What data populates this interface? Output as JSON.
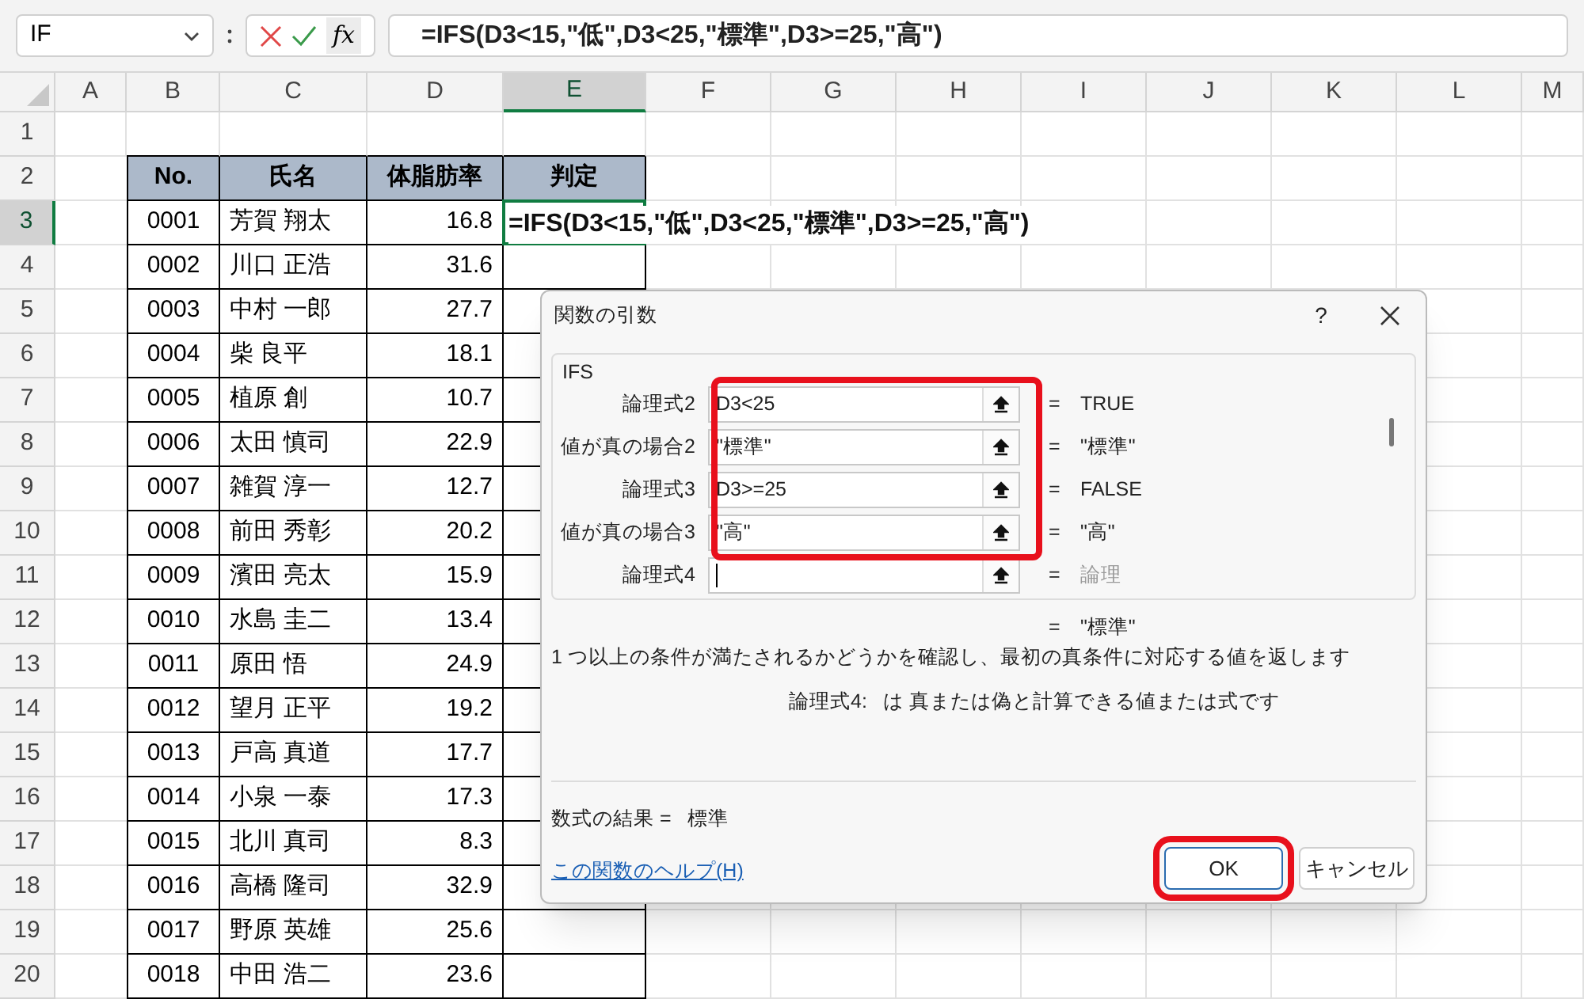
{
  "name_box": {
    "value": "IF"
  },
  "formula_bar": {
    "fx": "fx",
    "value": "=IFS(D3<15,\"低\",D3<25,\"標準\",D3>=25,\"高\")"
  },
  "columns": [
    {
      "label": "A",
      "selected": false
    },
    {
      "label": "B",
      "selected": false
    },
    {
      "label": "C",
      "selected": false
    },
    {
      "label": "D",
      "selected": false
    },
    {
      "label": "E",
      "selected": true
    },
    {
      "label": "F",
      "selected": false
    },
    {
      "label": "G",
      "selected": false
    },
    {
      "label": "H",
      "selected": false
    },
    {
      "label": "I",
      "selected": false
    },
    {
      "label": "J",
      "selected": false
    },
    {
      "label": "K",
      "selected": false
    },
    {
      "label": "L",
      "selected": false
    },
    {
      "label": "M",
      "selected": false
    }
  ],
  "rows": [
    {
      "label": "1",
      "selected": false,
      "kind": "blank"
    },
    {
      "label": "2",
      "selected": false,
      "kind": "header",
      "cells": [
        "No.",
        "氏名",
        "体脂肪率",
        "判定"
      ]
    },
    {
      "label": "3",
      "selected": true,
      "kind": "data",
      "cells": [
        "0001",
        "芳賀 翔太",
        "16.8"
      ],
      "active": true,
      "formula": "=IFS(D3<15,\"低\",D3<25,\"標準\",D3>=25,\"高\")"
    },
    {
      "label": "4",
      "selected": false,
      "kind": "data",
      "cells": [
        "0002",
        "川口 正浩",
        "31.6"
      ]
    },
    {
      "label": "5",
      "selected": false,
      "kind": "data",
      "cells": [
        "0003",
        "中村 一郎",
        "27.7"
      ]
    },
    {
      "label": "6",
      "selected": false,
      "kind": "data",
      "cells": [
        "0004",
        "柴 良平",
        "18.1"
      ]
    },
    {
      "label": "7",
      "selected": false,
      "kind": "data",
      "cells": [
        "0005",
        "植原 創",
        "10.7"
      ]
    },
    {
      "label": "8",
      "selected": false,
      "kind": "data",
      "cells": [
        "0006",
        "太田 慎司",
        "22.9"
      ]
    },
    {
      "label": "9",
      "selected": false,
      "kind": "data",
      "cells": [
        "0007",
        "雑賀 淳一",
        "12.7"
      ]
    },
    {
      "label": "10",
      "selected": false,
      "kind": "data",
      "cells": [
        "0008",
        "前田 秀彰",
        "20.2"
      ]
    },
    {
      "label": "11",
      "selected": false,
      "kind": "data",
      "cells": [
        "0009",
        "濱田 亮太",
        "15.9"
      ]
    },
    {
      "label": "12",
      "selected": false,
      "kind": "data",
      "cells": [
        "0010",
        "水島 圭二",
        "13.4"
      ]
    },
    {
      "label": "13",
      "selected": false,
      "kind": "data",
      "cells": [
        "0011",
        "原田 悟",
        "24.9"
      ]
    },
    {
      "label": "14",
      "selected": false,
      "kind": "data",
      "cells": [
        "0012",
        "望月 正平",
        "19.2"
      ]
    },
    {
      "label": "15",
      "selected": false,
      "kind": "data",
      "cells": [
        "0013",
        "戸高 真道",
        "17.7"
      ]
    },
    {
      "label": "16",
      "selected": false,
      "kind": "data",
      "cells": [
        "0014",
        "小泉 一泰",
        "17.3"
      ]
    },
    {
      "label": "17",
      "selected": false,
      "kind": "data",
      "cells": [
        "0015",
        "北川 真司",
        "8.3"
      ]
    },
    {
      "label": "18",
      "selected": false,
      "kind": "data",
      "cells": [
        "0016",
        "高橋 隆司",
        "32.9"
      ]
    },
    {
      "label": "19",
      "selected": false,
      "kind": "data",
      "cells": [
        "0017",
        "野原 英雄",
        "25.6"
      ]
    },
    {
      "label": "20",
      "selected": false,
      "kind": "data",
      "cells": [
        "0018",
        "中田 浩二",
        "23.6"
      ]
    }
  ],
  "dialog": {
    "title": "関数の引数",
    "help": "?",
    "function_name": "IFS",
    "arguments": [
      {
        "label": "論理式2",
        "value": "D3<25",
        "equals": "=",
        "result": "TRUE",
        "result_dim": false,
        "highlighted": true,
        "focused": false
      },
      {
        "label": "値が真の場合2",
        "value": "\"標準\"",
        "equals": "=",
        "result": "\"標準\"",
        "result_dim": false,
        "highlighted": true,
        "focused": false
      },
      {
        "label": "論理式3",
        "value": "D3>=25",
        "equals": "=",
        "result": "FALSE",
        "result_dim": false,
        "highlighted": true,
        "focused": false
      },
      {
        "label": "値が真の場合3",
        "value": "\"高\"",
        "equals": "=",
        "result": "\"高\"",
        "result_dim": false,
        "highlighted": true,
        "focused": false
      },
      {
        "label": "論理式4",
        "equals": "=",
        "result": "論理",
        "result_dim": true,
        "highlighted": false,
        "focused": true
      }
    ],
    "overall": {
      "equals": "=",
      "result": "\"標準\""
    },
    "description": "1 つ以上の条件が満たされるかどうかを確認し、最初の真条件に対応する値を返します",
    "argument_help": {
      "name": "論理式4:",
      "text": "は 真または偽と計算できる値または式です"
    },
    "formula_result": {
      "label": "数式の結果 =",
      "value": "標準"
    },
    "help_link": "この関数のヘルプ(H)",
    "buttons": [
      {
        "label": "OK",
        "highlighted": true
      },
      {
        "label": "キャンセル",
        "highlighted": false
      }
    ]
  }
}
